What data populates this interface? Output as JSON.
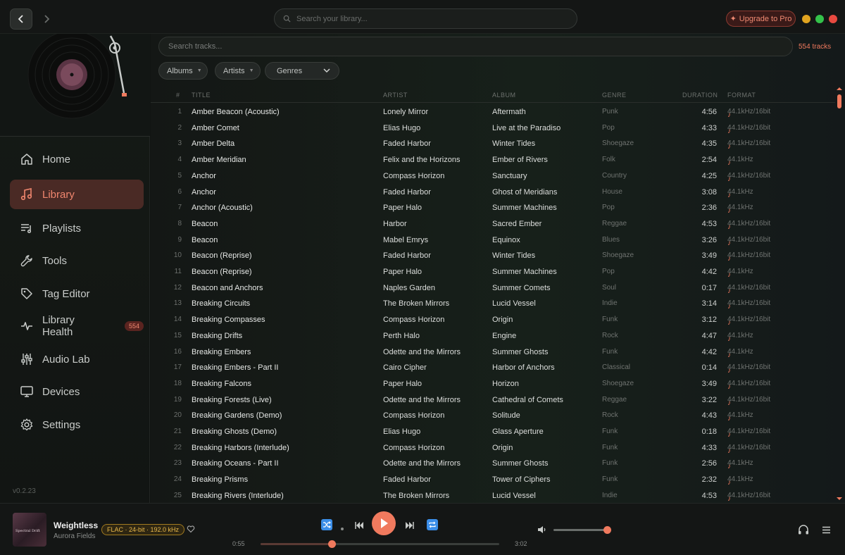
{
  "window": {
    "search_placeholder": "Search your library...",
    "upgrade_label": "Upgrade to Pro",
    "upgrade_icon": "✦",
    "window_buttons": [
      "#e0a420",
      "#e8b020",
      "#34c24a",
      "#e84a40"
    ]
  },
  "sidebar": {
    "items": [
      {
        "label": "Home",
        "icon": "home-icon"
      },
      {
        "label": "Library",
        "icon": "music-note-icon",
        "active": true
      },
      {
        "label": "Playlists",
        "icon": "playlist-icon"
      },
      {
        "label": "Tools",
        "icon": "wrench-icon"
      },
      {
        "label": "Tag Editor",
        "icon": "tag-icon"
      },
      {
        "label": "Library Health",
        "icon": "pulse-icon",
        "badge": "554"
      },
      {
        "label": "Audio Lab",
        "icon": "sliders-icon"
      },
      {
        "label": "Devices",
        "icon": "monitor-icon"
      },
      {
        "label": "Settings",
        "icon": "gear-icon"
      }
    ],
    "version": "v0.2.23"
  },
  "library": {
    "search_placeholder": "Search tracks...",
    "track_count": "554 tracks",
    "filters": {
      "albums": "Albums",
      "artists": "Artists",
      "genres": "Genres"
    },
    "columns": {
      "num": "#",
      "title": "TITLE",
      "artist": "ARTIST",
      "album": "ALBUM",
      "genre": "GENRE",
      "duration": "DURATION",
      "format": "FORMAT"
    },
    "rows": [
      {
        "num": "1",
        "title": "Amber Beacon (Acoustic)",
        "artist": "Lonely Mirror",
        "album": "Aftermath",
        "genre": "Punk",
        "duration": "4:56",
        "format": "44.1kHz/16bit"
      },
      {
        "num": "2",
        "title": "Amber Comet",
        "artist": "Elias Hugo",
        "album": "Live at the Paradiso",
        "genre": "Pop",
        "duration": "4:33",
        "format": "44.1kHz/16bit"
      },
      {
        "num": "3",
        "title": "Amber Delta",
        "artist": "Faded Harbor",
        "album": "Winter Tides",
        "genre": "Shoegaze",
        "duration": "4:35",
        "format": "44.1kHz/16bit"
      },
      {
        "num": "4",
        "title": "Amber Meridian",
        "artist": "Felix and the Horizons",
        "album": "Ember of Rivers",
        "genre": "Folk",
        "duration": "2:54",
        "format": "44.1kHz"
      },
      {
        "num": "5",
        "title": "Anchor",
        "artist": "Compass Horizon",
        "album": "Sanctuary",
        "genre": "Country",
        "duration": "4:25",
        "format": "44.1kHz/16bit"
      },
      {
        "num": "6",
        "title": "Anchor",
        "artist": "Faded Harbor",
        "album": "Ghost of Meridians",
        "genre": "House",
        "duration": "3:08",
        "format": "44.1kHz"
      },
      {
        "num": "7",
        "title": "Anchor (Acoustic)",
        "artist": "Paper Halo",
        "album": "Summer Machines",
        "genre": "Pop",
        "duration": "2:36",
        "format": "44.1kHz"
      },
      {
        "num": "8",
        "title": "Beacon",
        "artist": "Harbor",
        "album": "Sacred Ember",
        "genre": "Reggae",
        "duration": "4:53",
        "format": "44.1kHz/16bit"
      },
      {
        "num": "9",
        "title": "Beacon",
        "artist": "Mabel Emrys",
        "album": "Equinox",
        "genre": "Blues",
        "duration": "3:26",
        "format": "44.1kHz/16bit"
      },
      {
        "num": "10",
        "title": "Beacon (Reprise)",
        "artist": "Faded Harbor",
        "album": "Winter Tides",
        "genre": "Shoegaze",
        "duration": "3:49",
        "format": "44.1kHz/16bit"
      },
      {
        "num": "11",
        "title": "Beacon (Reprise)",
        "artist": "Paper Halo",
        "album": "Summer Machines",
        "genre": "Pop",
        "duration": "4:42",
        "format": "44.1kHz"
      },
      {
        "num": "12",
        "title": "Beacon and Anchors",
        "artist": "Naples Garden",
        "album": "Summer Comets",
        "genre": "Soul",
        "duration": "0:17",
        "format": "44.1kHz/16bit"
      },
      {
        "num": "13",
        "title": "Breaking Circuits",
        "artist": "The Broken Mirrors",
        "album": "Lucid Vessel",
        "genre": "Indie",
        "duration": "3:14",
        "format": "44.1kHz/16bit"
      },
      {
        "num": "14",
        "title": "Breaking Compasses",
        "artist": "Compass Horizon",
        "album": "Origin",
        "genre": "Funk",
        "duration": "3:12",
        "format": "44.1kHz/16bit"
      },
      {
        "num": "15",
        "title": "Breaking Drifts",
        "artist": "Perth Halo",
        "album": "Engine",
        "genre": "Rock",
        "duration": "4:47",
        "format": "44.1kHz"
      },
      {
        "num": "16",
        "title": "Breaking Embers",
        "artist": "Odette and the Mirrors",
        "album": "Summer Ghosts",
        "genre": "Funk",
        "duration": "4:42",
        "format": "44.1kHz"
      },
      {
        "num": "17",
        "title": "Breaking Embers - Part II",
        "artist": "Cairo Cipher",
        "album": "Harbor of Anchors",
        "genre": "Classical",
        "duration": "0:14",
        "format": "44.1kHz/16bit"
      },
      {
        "num": "18",
        "title": "Breaking Falcons",
        "artist": "Paper Halo",
        "album": "Horizon",
        "genre": "Shoegaze",
        "duration": "3:49",
        "format": "44.1kHz/16bit"
      },
      {
        "num": "19",
        "title": "Breaking Forests (Live)",
        "artist": "Odette and the Mirrors",
        "album": "Cathedral of Comets",
        "genre": "Reggae",
        "duration": "3:22",
        "format": "44.1kHz/16bit"
      },
      {
        "num": "20",
        "title": "Breaking Gardens (Demo)",
        "artist": "Compass Horizon",
        "album": "Solitude",
        "genre": "Rock",
        "duration": "4:43",
        "format": "44.1kHz"
      },
      {
        "num": "21",
        "title": "Breaking Ghosts (Demo)",
        "artist": "Elias Hugo",
        "album": "Glass Aperture",
        "genre": "Funk",
        "duration": "0:18",
        "format": "44.1kHz/16bit"
      },
      {
        "num": "22",
        "title": "Breaking Harbors (Interlude)",
        "artist": "Compass Horizon",
        "album": "Origin",
        "genre": "Funk",
        "duration": "4:33",
        "format": "44.1kHz/16bit"
      },
      {
        "num": "23",
        "title": "Breaking Oceans - Part II",
        "artist": "Odette and the Mirrors",
        "album": "Summer Ghosts",
        "genre": "Funk",
        "duration": "2:56",
        "format": "44.1kHz"
      },
      {
        "num": "24",
        "title": "Breaking Prisms",
        "artist": "Faded Harbor",
        "album": "Tower of Ciphers",
        "genre": "Funk",
        "duration": "2:32",
        "format": "44.1kHz"
      },
      {
        "num": "25",
        "title": "Breaking Rivers (Interlude)",
        "artist": "The Broken Mirrors",
        "album": "Lucid Vessel",
        "genre": "Indie",
        "duration": "4:53",
        "format": "44.1kHz/16bit"
      }
    ]
  },
  "player": {
    "cover_text": "Spectral Drift",
    "title": "Weightless",
    "artist": "Aurora Fields",
    "quality": "FLAC · 24-bit · 192.0 kHz",
    "elapsed": "0:55",
    "total": "3:02",
    "progress_fraction": 0.3,
    "volume_fraction": 0.96
  },
  "colors": {
    "accent": "#f07a5e",
    "active_nav_bg": "#4a2a25",
    "quality_badge": "#e8b84a"
  }
}
